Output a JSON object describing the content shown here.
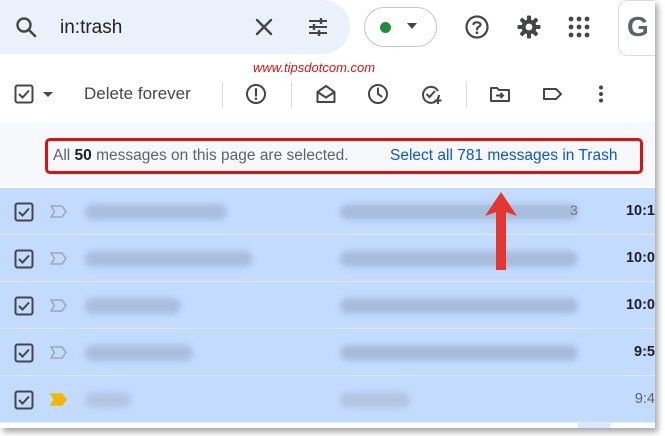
{
  "search": {
    "query": "in:trash"
  },
  "account": {
    "letter": "G"
  },
  "watermark": "www.tipsdotcom.com",
  "toolbar": {
    "delete_label": "Delete forever"
  },
  "selection_notice": {
    "prefix": "All ",
    "count": "50",
    "suffix": " messages on this page are selected.",
    "link": "Select all 781 messages in Trash"
  },
  "rows": [
    {
      "time": "10:1",
      "important": false,
      "stray": "3"
    },
    {
      "time": "10:0",
      "important": false,
      "stray": ""
    },
    {
      "time": "10:0",
      "important": false,
      "stray": ""
    },
    {
      "time": "9:5",
      "important": false,
      "stray": ""
    },
    {
      "time": "9:4",
      "important": true,
      "stray": ""
    }
  ],
  "colors": {
    "accent": "#0b57d0",
    "highlight": "#e01010",
    "row_selected": "#c2dbff",
    "important_marker": "#f2b705",
    "online": "#1e8e3e"
  }
}
